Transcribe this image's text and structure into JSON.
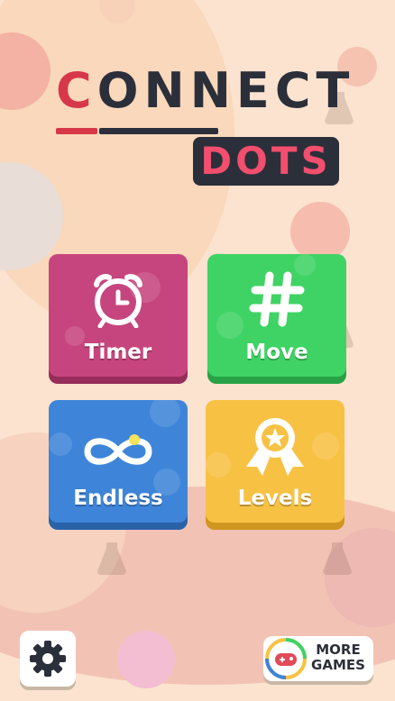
{
  "logo": {
    "connect_red": "C",
    "connect_rest": "ONNECT",
    "dots": "DOTS"
  },
  "modes": [
    {
      "label": "Timer",
      "icon": "alarm-clock-icon",
      "color": "#c7457e"
    },
    {
      "label": "Move",
      "icon": "hashtag-icon",
      "color": "#3fd365"
    },
    {
      "label": "Endless",
      "icon": "infinity-icon",
      "color": "#3e85d9"
    },
    {
      "label": "Levels",
      "icon": "medal-star-icon",
      "color": "#f7c244"
    }
  ],
  "footer": {
    "settings_icon": "gear-icon",
    "more_games_line1": "MORE",
    "more_games_line2": "GAMES"
  }
}
